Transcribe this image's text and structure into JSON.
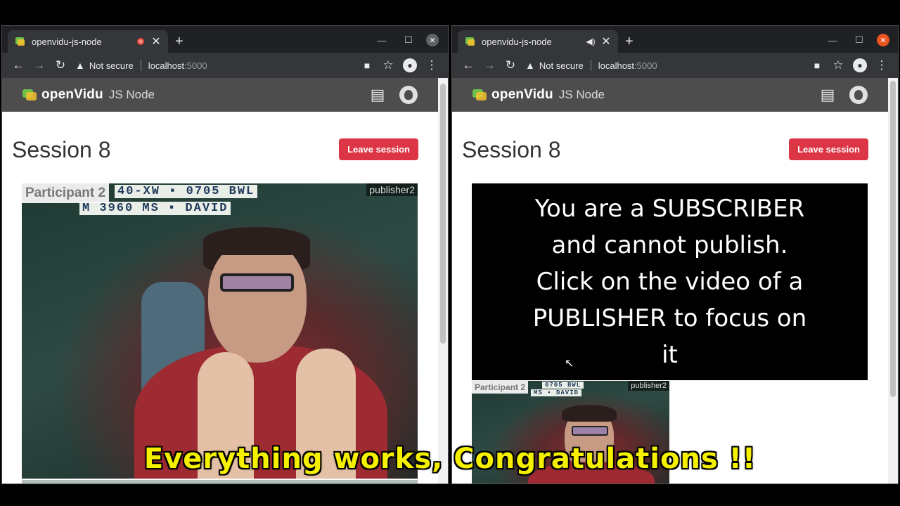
{
  "left_window": {
    "tab": {
      "title": "openvidu-js-node",
      "indicator": "recording-dot"
    },
    "toolbar": {
      "security": "Not secure",
      "url_host": "localhost",
      "url_port": ":5000"
    },
    "app": {
      "brand": "openVidu",
      "brand_sub": "JS Node",
      "session_title": "Session 8",
      "leave_label": "Leave session",
      "video": {
        "participant_label": "Participant 2",
        "publisher_label": "publisher2",
        "plate_top": "40-XW ▪ 0705 BWL",
        "plate_bottom": "M 3960 MS ▪ DAVID"
      }
    }
  },
  "right_window": {
    "tab": {
      "title": "openvidu-js-node",
      "indicator": "audio-speaker"
    },
    "toolbar": {
      "security": "Not secure",
      "url_host": "localhost",
      "url_port": ":5000"
    },
    "app": {
      "brand": "openVidu",
      "brand_sub": "JS Node",
      "session_title": "Session 8",
      "leave_label": "Leave session",
      "subscriber_message": "You are a SUBSCRIBER and cannot publish. Click on the video of a PUBLISHER to focus on it",
      "thumb": {
        "participant_label": "Participant 2",
        "publisher_label": "publisher2",
        "plate_top": "0705 BWL",
        "plate_bottom": "MS ▪ DAVID"
      }
    }
  },
  "caption": "Everything works, Congratulations !!",
  "colors": {
    "leave_button": "#dc3545",
    "navbar": "#4d4d4d",
    "caption": "#f5f000",
    "chrome_dark": "#35363a"
  }
}
